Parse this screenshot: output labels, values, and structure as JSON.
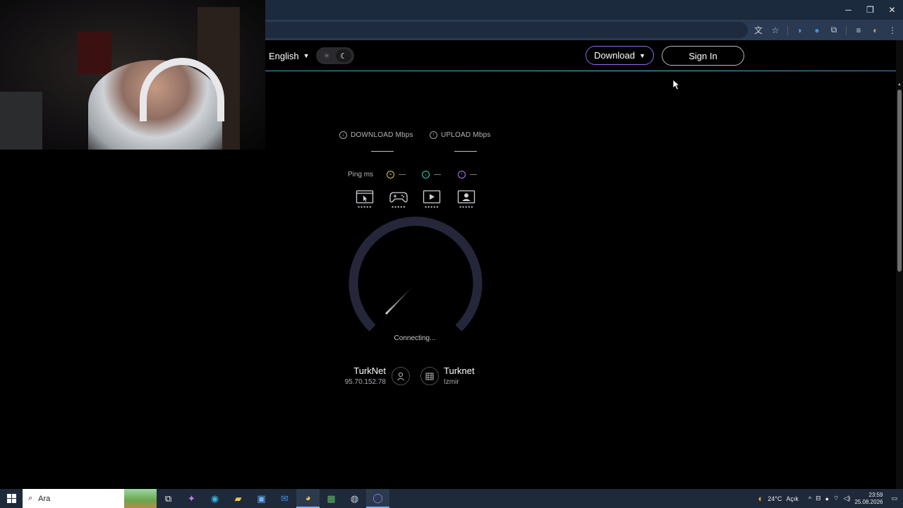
{
  "browser": {
    "window_controls": {
      "minimize": "─",
      "restore": "❐",
      "close": "✕"
    },
    "extension_icons": [
      "translate-icon",
      "star-icon",
      "extension-a-icon",
      "extension-b-icon",
      "puzzle-icon",
      "media-icon",
      "profile-icon",
      "more-icon"
    ]
  },
  "site": {
    "language": "English",
    "download_label": "Download",
    "signin_label": "Sign In",
    "accent_color": "#8b6cf0",
    "header_line_color": "#52c3e0"
  },
  "metrics": {
    "download_label": "DOWNLOAD Mbps",
    "upload_label": "UPLOAD Mbps",
    "ping_label": "Ping ms",
    "ping_idle": "—",
    "ping_download": "—",
    "ping_upload": "—",
    "qos_icons": [
      "browsing-icon",
      "gaming-icon",
      "streaming-icon",
      "video-call-icon"
    ],
    "qos_dots": "●●●●●"
  },
  "gauge": {
    "status": "Connecting..."
  },
  "connection": {
    "isp_name": "TurkNet",
    "isp_ip": "95.70.152.78",
    "server_name": "Turknet",
    "server_city": "Izmir"
  },
  "taskbar": {
    "search_placeholder": "Ara",
    "weather_temp": "24°C",
    "weather_desc": "Açık",
    "time": "23:59",
    "date": "25.08.2026"
  }
}
